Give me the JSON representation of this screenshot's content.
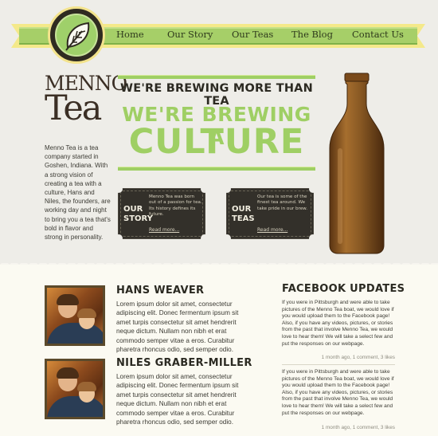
{
  "nav": {
    "items": [
      {
        "label": "Home"
      },
      {
        "label": "Our Story"
      },
      {
        "label": "Our Teas"
      },
      {
        "label": "The Blog"
      },
      {
        "label": "Contact Us"
      }
    ]
  },
  "logo": {
    "line1": "MENNO",
    "line2": "Tea"
  },
  "intro": "Menno Tea is a tea company started in Goshen, Indiana. With a strong vision of creating a tea with a culture, Hans and Niles, the founders, are working day and night to bring you a tea that's bold in flavor and strong in personality.",
  "headline": {
    "line1": "WE'RE BREWING MORE THAN TEA",
    "line2": "WE'RE BREWING A",
    "line3": "CULTURE"
  },
  "tickets": [
    {
      "label_line1": "OUR",
      "label_line2": "STORY",
      "desc": "Menno Tea was born out of a passion for tea. Its history defines its future.",
      "more": "Read more..."
    },
    {
      "label_line1": "OUR",
      "label_line2": "TEAS",
      "desc": "Our tea is some of the finest tea around. We take pride in our brew.",
      "more": "Read more..."
    }
  ],
  "people": [
    {
      "name": "HANS WEAVER",
      "bio": "Lorem ipsum dolor sit amet, consectetur adipiscing elit. Donec fermentum ipsum sit amet turpis consectetur sit amet hendrerit neque dictum. Nullam non nibh et erat commodo semper vitae a eros. Curabitur pharetra rhoncus odio, sed semper odio."
    },
    {
      "name": "NILES GRABER-MILLER",
      "bio": "Lorem ipsum dolor sit amet, consectetur adipiscing elit. Donec fermentum ipsum sit amet turpis consectetur sit amet hendrerit neque dictum. Nullam non nibh et erat commodo semper vitae a eros. Curabitur pharetra rhoncus odio, sed semper odio."
    }
  ],
  "facebook": {
    "title": "FACEBOOK UPDATES",
    "posts": [
      {
        "text": "If you were in Pittsburgh and were able to take pictures of the Menno Tea boat, we would love if you would upload them to the Facebook page! Also, if you have any videos, pictures, or stories from the past that involve Menno Tea, we would love to hear them! We will take a select few and put the responses on our webpage.",
        "meta": "1 month ago, 1 comment, 3 likes"
      },
      {
        "text": "If you were in Pittsburgh and were able to take pictures of the Menno Tea boat, we would love if you would upload them to the Facebook page! Also, if you have any videos, pictures, or stories from the past that involve Menno Tea, we would love to hear them! We will take a select few and put the responses on our webpage.",
        "meta": "1 month ago, 1 comment, 3 likes"
      }
    ]
  },
  "colors": {
    "accent_green": "#9fcf64",
    "ribbon_yellow": "#f4e98a",
    "dark": "#33302a",
    "bottle_amber": "#8a5a24"
  },
  "icons": {
    "logo_badge": "leaf-icon"
  }
}
